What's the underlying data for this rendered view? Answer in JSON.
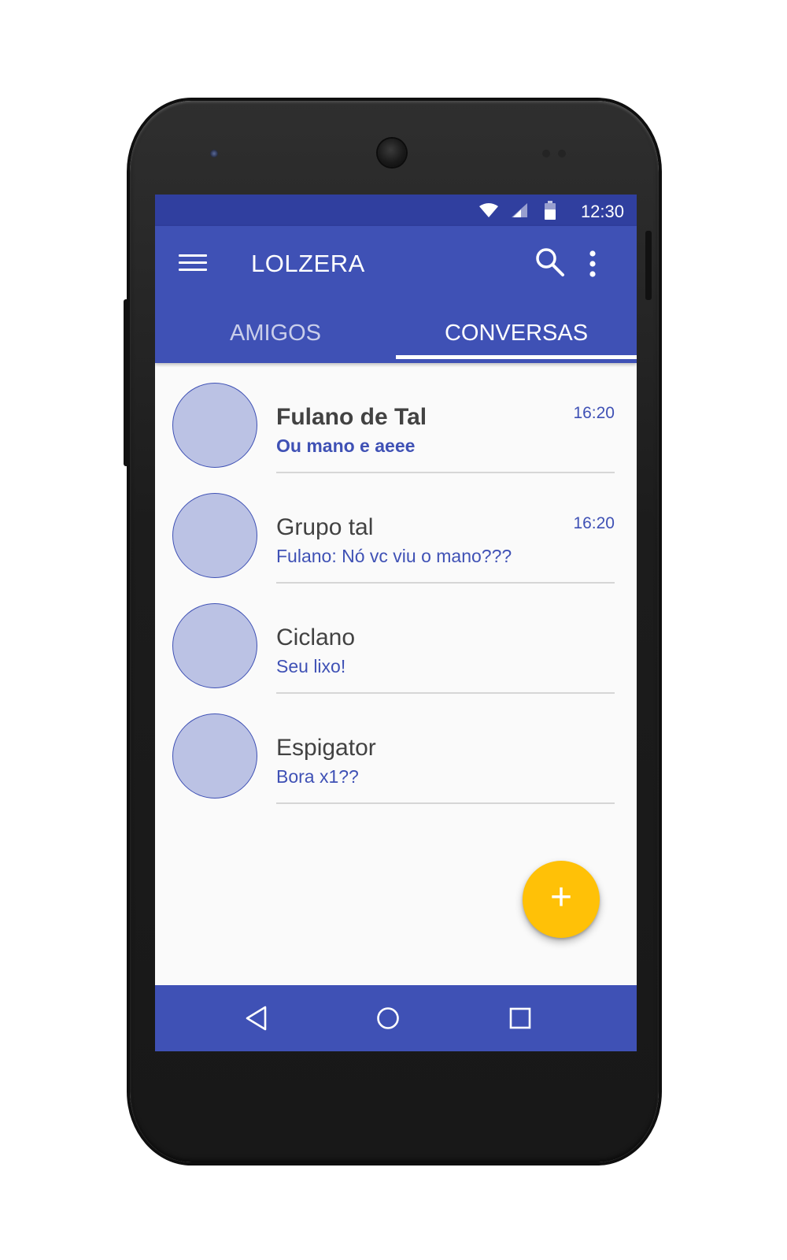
{
  "status_bar": {
    "time": "12:30"
  },
  "app_bar": {
    "title": "LOLZERA",
    "menu_icon": "hamburger-menu-icon",
    "search_icon": "search-icon",
    "more_icon": "more-vert-icon"
  },
  "tabs": [
    {
      "label": "AMIGOS",
      "selected": false
    },
    {
      "label": "CONVERSAS",
      "selected": true
    }
  ],
  "conversations": [
    {
      "name": "Fulano de Tal",
      "preview": "Ou mano e aeee",
      "time": "16:20",
      "unread": true
    },
    {
      "name": "Grupo tal",
      "preview": "Fulano: Nó vc viu o mano???",
      "time": "16:20",
      "unread": false
    },
    {
      "name": "Ciclano",
      "preview": "Seu lixo!",
      "time": "",
      "unread": false
    },
    {
      "name": "Espigator",
      "preview": "Bora x1??",
      "time": "",
      "unread": false
    }
  ],
  "fab": {
    "label": "+",
    "icon": "add-icon"
  },
  "nav_bar": {
    "back_icon": "back-triangle-icon",
    "home_icon": "home-circle-icon",
    "recents_icon": "recents-square-icon"
  },
  "colors": {
    "primary": "#3f51b5",
    "primary_dark": "#303f9f",
    "accent": "#ffc107",
    "avatar_fill": "#bbc2e4",
    "background": "#fafafa"
  }
}
